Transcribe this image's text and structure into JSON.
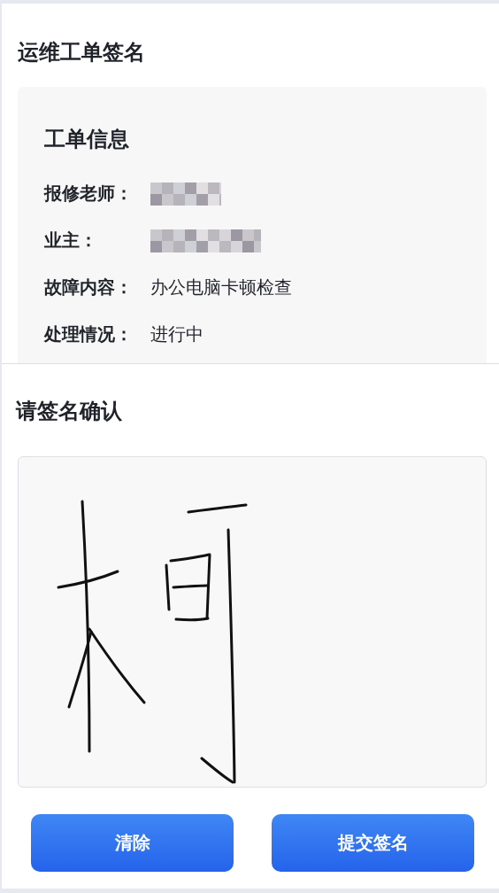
{
  "page_title": "运维工单签名",
  "order_info": {
    "heading": "工单信息",
    "rows": [
      {
        "kind": "redacted",
        "label": "报修老师："
      },
      {
        "kind": "redacted",
        "label": "业主："
      },
      {
        "kind": "text",
        "label": "故障内容：",
        "value": "办公电脑卡顿检查"
      },
      {
        "kind": "text",
        "label": "处理情况：",
        "value": "进行中"
      }
    ]
  },
  "signature": {
    "heading": "请签名确认"
  },
  "buttons": [
    {
      "label": "清除"
    },
    {
      "label": "提交签名"
    }
  ]
}
